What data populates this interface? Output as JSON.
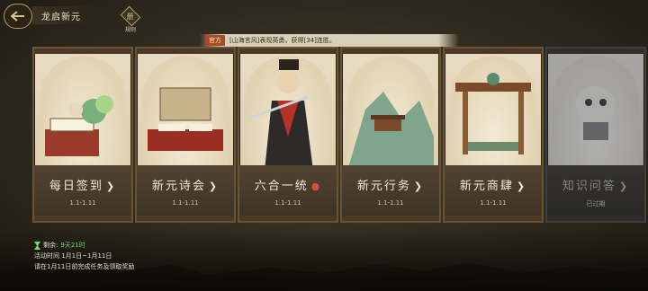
{
  "header": {
    "title": "龙启新元",
    "rules_label": "规则",
    "rules_glyph": "册"
  },
  "announcement": {
    "tag": "官方",
    "text": "[山海言风]表现英勇，获得[34]连胜。"
  },
  "cards": [
    {
      "name": "每日签到",
      "date": "1.1-1.11"
    },
    {
      "name": "新元诗会",
      "date": "1.1-1.11"
    },
    {
      "name": "六合一统",
      "date": "1.1-1.11"
    },
    {
      "name": "新元行务",
      "date": "1.1-1.11"
    },
    {
      "name": "新元商肆",
      "date": "1.1-1.11"
    },
    {
      "name": "知识问答",
      "date": "已过期"
    }
  ],
  "footer": {
    "remaining_label": "剩余:",
    "remaining_value": "9天21时",
    "time_line": "活动时间 1月1日~1月11日",
    "notice_line": "请在1月11日前完成任务及领取奖励"
  },
  "colors": {
    "accent_green": "#78d86a",
    "tag_red": "#a84a2a",
    "gold": "#b89a5a"
  }
}
